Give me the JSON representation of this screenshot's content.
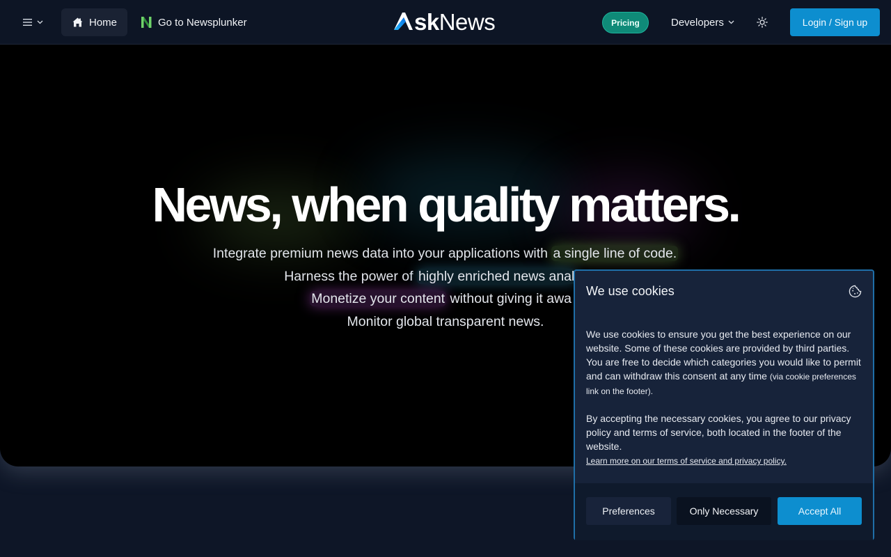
{
  "nav": {
    "home_label": "Home",
    "newsplunker_label": "Go to Newsplunker",
    "logo_prefix": "sk",
    "logo_suffix": "News",
    "pricing_label": "Pricing",
    "developers_label": "Developers",
    "login_label": "Login / Sign up"
  },
  "hero": {
    "headline": "News, when quality matters.",
    "line1_pre": "Integrate premium news data into your applications with ",
    "line1_hl": "a single line of code.",
    "line2_pre": "Harness the power of ",
    "line2_hl": "highly enriched news anal",
    "line3_hl": "Monetize your content",
    "line3_post": " without giving it awa",
    "line4": "Monitor global transparent news."
  },
  "cookie": {
    "title": "We use cookies",
    "p1": "We use cookies to ensure you get the best experience on our website. Some of these cookies are provided by third parties. You are free to decide which categories you would like to permit and can withdraw this consent at any time ",
    "p1_small": "(via cookie preferences link on the footer).",
    "p2": "By accepting the necessary cookies, you agree to our privacy policy and terms of service, both located in the footer of the website.",
    "link": "Learn more on our terms of service and privacy policy.",
    "preferences_label": "Preferences",
    "necessary_label": "Only Necessary",
    "accept_label": "Accept All"
  },
  "colors": {
    "nav_bg": "#0d1525",
    "accent": "#0d8ecf",
    "pricing": "#0f8a78",
    "hero_bg": "#000000",
    "cookie_bg": "#17233a"
  },
  "icons": {
    "menu": "hamburger-icon",
    "home": "home-icon",
    "newsplunker": "newsplunker-logo",
    "theme": "sun-icon",
    "cookie": "cookie-icon"
  }
}
